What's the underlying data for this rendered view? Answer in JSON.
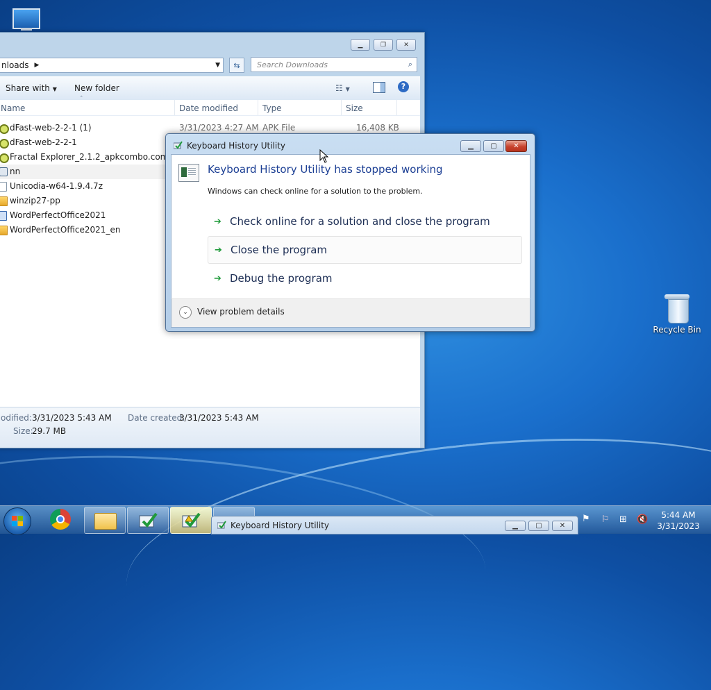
{
  "desktop": {
    "recycle_bin_label": "Recycle Bin"
  },
  "explorer": {
    "address_text": "nloads",
    "search_placeholder": "Search Downloads",
    "toolbar": {
      "share_with": "Share with",
      "new_folder": "New folder"
    },
    "columns": {
      "name": "Name",
      "date_modified": "Date modified",
      "type": "Type",
      "size": "Size"
    },
    "files": [
      {
        "name": "dFast-web-2-2-1 (1)",
        "date": "3/31/2023 4:27 AM",
        "type": "APK File",
        "size": "16,408 KB",
        "icon": "apk-icon"
      },
      {
        "name": "dFast-web-2-2-1",
        "date": "",
        "type": "",
        "size": "",
        "icon": "apk-icon"
      },
      {
        "name": "Fractal Explorer_2.1.2_apkcombo.com",
        "date": "",
        "type": "",
        "size": "",
        "icon": "apk-icon"
      },
      {
        "name": "nn",
        "date": "",
        "type": "",
        "size": "",
        "icon": "app-icon"
      },
      {
        "name": "Unicodia-w64-1.9.4.7z",
        "date": "",
        "type": "",
        "size": "",
        "icon": "document-icon"
      },
      {
        "name": "winzip27-pp",
        "date": "",
        "type": "",
        "size": "",
        "icon": "zip-icon"
      },
      {
        "name": "WordPerfectOffice2021",
        "date": "",
        "type": "",
        "size": "",
        "icon": "installer-icon"
      },
      {
        "name": "WordPerfectOffice2021_en",
        "date": "",
        "type": "",
        "size": "",
        "icon": "zip-icon"
      }
    ],
    "details": {
      "modified_label": "odified:",
      "modified_value": "3/31/2023 5:43 AM",
      "created_label": "Date created:",
      "created_value": "3/31/2023 5:43 AM",
      "size_label": "Size:",
      "size_value": "29.7 MB"
    }
  },
  "dialog": {
    "title": "Keyboard History Utility",
    "heading": "Keyboard History Utility has stopped working",
    "subtext": "Windows can check online for a solution to the problem.",
    "options": [
      "Check online for a solution and close the program",
      "Close the program",
      "Debug the program"
    ],
    "details_toggle": "View problem details"
  },
  "taskbar": {
    "preview_title": "Keyboard History Utility",
    "clock_time": "5:44 AM",
    "clock_date": "3/31/2023"
  }
}
